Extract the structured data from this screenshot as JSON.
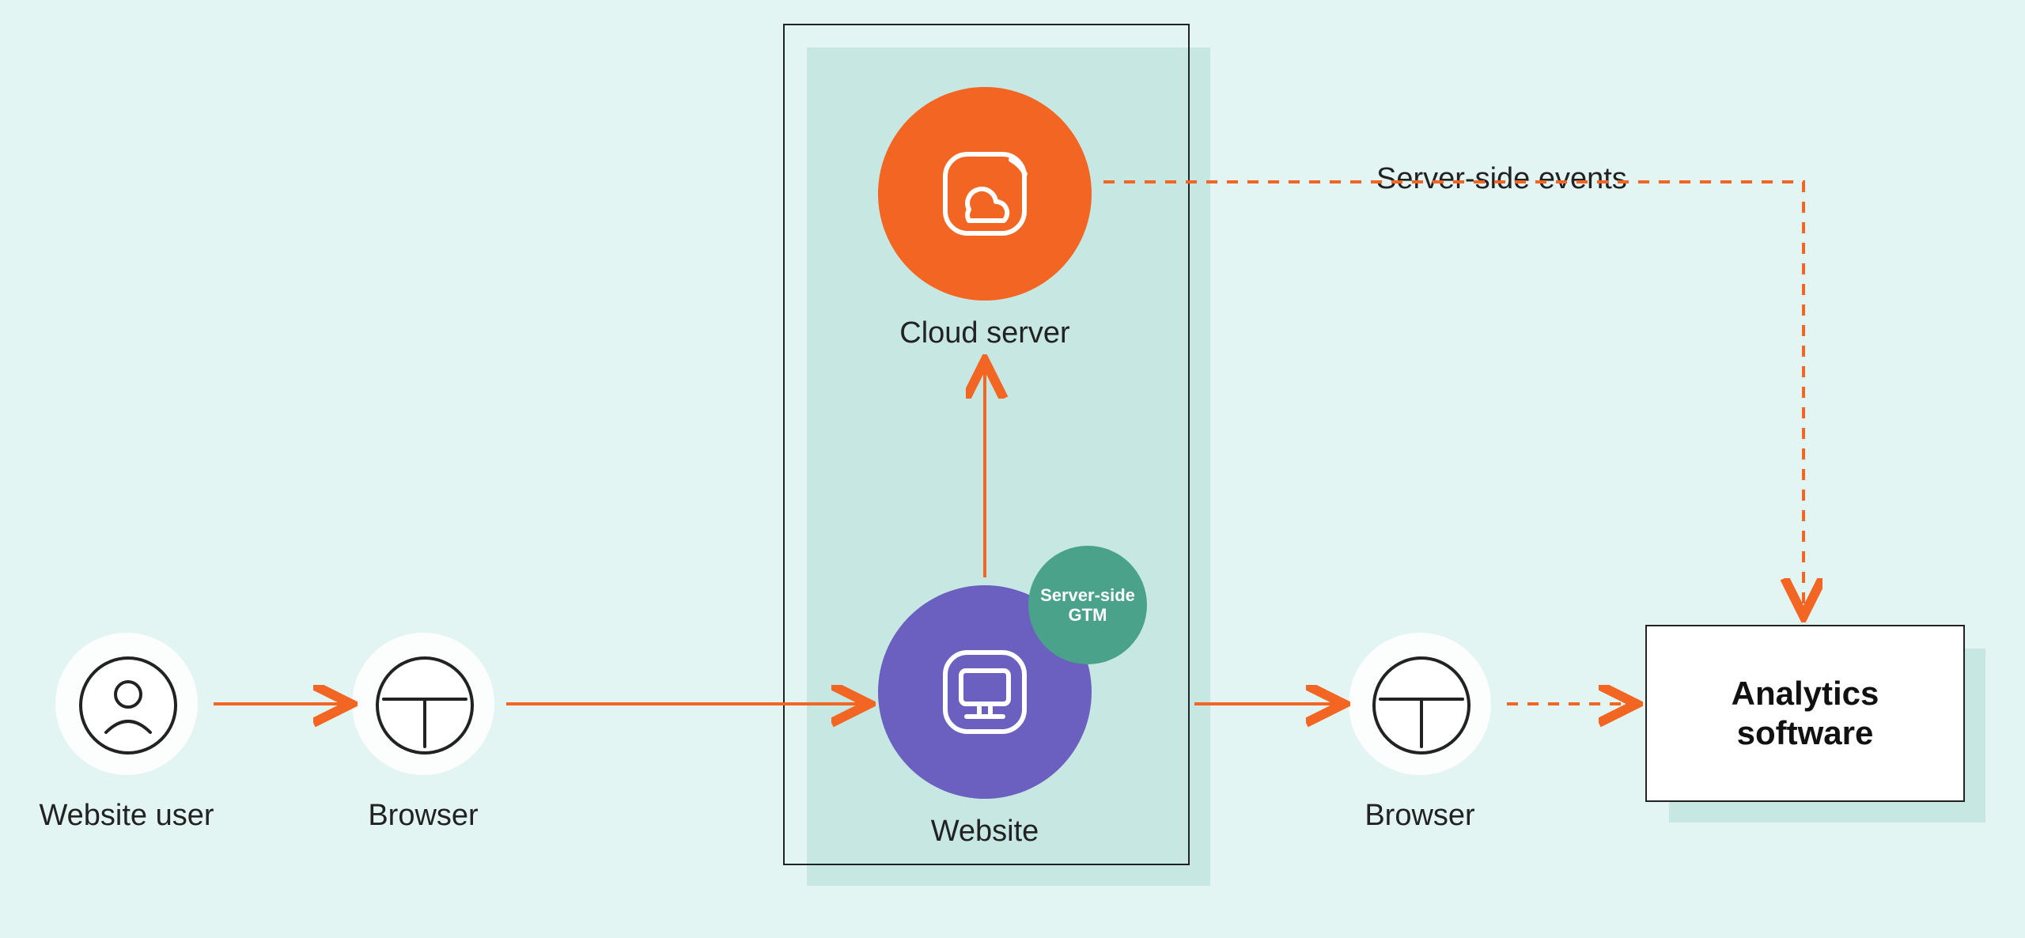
{
  "nodes": {
    "user": {
      "label": "Website user"
    },
    "browser1": {
      "label": "Browser"
    },
    "cloud": {
      "label": "Cloud server"
    },
    "website": {
      "label": "Website"
    },
    "gtm_badge": {
      "line1": "Server-side",
      "line2": "GTM"
    },
    "browser2": {
      "label": "Browser"
    },
    "analytics": {
      "line1": "Analytics",
      "line2": "software"
    }
  },
  "edges": {
    "sse": {
      "label": "Server-side events"
    }
  },
  "colors": {
    "bg": "#e3f5f2",
    "accent": "#f26522",
    "purple": "#6b5fc0",
    "green": "#4aa28a"
  }
}
